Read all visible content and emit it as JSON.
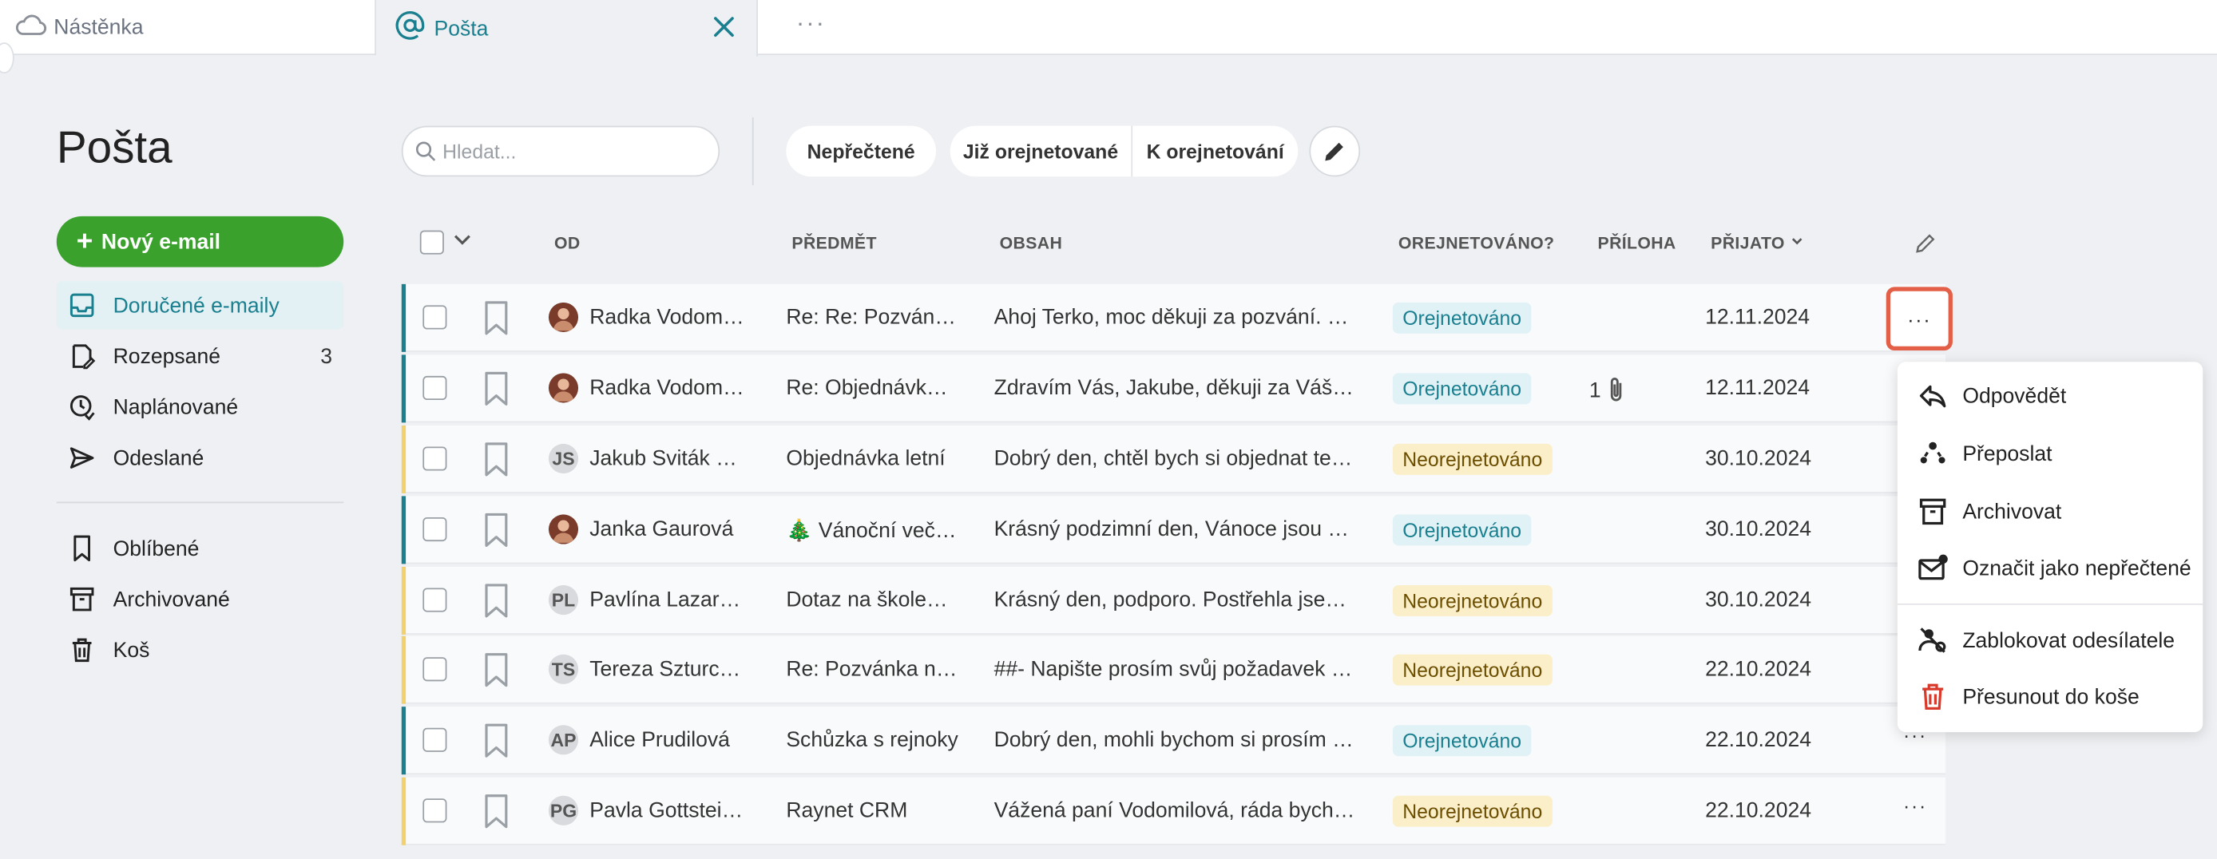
{
  "tabs": [
    {
      "label": "Nástěnka",
      "icon": "cloud-icon"
    },
    {
      "label": "Pošta",
      "icon": "at-icon",
      "active": true
    }
  ],
  "tab_more": "···",
  "page_title": "Pošta",
  "new_email_label": "Nový e-mail",
  "nav": [
    {
      "label": "Doručené e-maily",
      "icon": "inbox-icon",
      "active": true
    },
    {
      "label": "Rozepsané",
      "icon": "draft-icon",
      "count": "3"
    },
    {
      "label": "Naplánované",
      "icon": "schedule-icon"
    },
    {
      "label": "Odeslané",
      "icon": "send-icon"
    },
    {
      "label": "Oblíbené",
      "icon": "bookmark-icon"
    },
    {
      "label": "Archivované",
      "icon": "archive-icon"
    },
    {
      "label": "Koš",
      "icon": "trash-icon"
    }
  ],
  "search": {
    "placeholder": "Hledat..."
  },
  "filters": {
    "unread": "Nepřečtené",
    "rated": "Již orejnetované",
    "to_rate": "K orejnetování"
  },
  "columns": {
    "from": "OD",
    "subject": "PŘEDMĚT",
    "content": "OBSAH",
    "rated": "OREJNETOVÁNO?",
    "attachment": "PŘÍLOHA",
    "received": "PŘIJATO"
  },
  "colors": {
    "accent": "#1a7f8e",
    "primary_green": "#3aa12d",
    "highlight": "#e35f47"
  },
  "rows": [
    {
      "from": "Radka Vodomilová",
      "initials": "",
      "photo": true,
      "subject": "Re: Re: Pozvánka na Vánoční večírek",
      "body": "Ahoj Terko, moc děkuji za pozvání. Určitě dorazím.",
      "status": "Orejnetováno",
      "status_type": "yes",
      "attachment": "",
      "date": "12.11.2024"
    },
    {
      "from": "Radka Vodomilová",
      "initials": "",
      "photo": true,
      "subject": "Re: Objednávka letní",
      "body": "Zdravím Vás, Jakube, děkuji za Váš zájem",
      "status": "Orejnetováno",
      "status_type": "yes",
      "attachment": "1",
      "date": "12.11.2024"
    },
    {
      "from": "Jakub Sviták pozvánka",
      "initials": "JS",
      "photo": false,
      "subject": "Objednávka letní",
      "body": "Dobrý den, chtěl bych si objednat ten letní",
      "status": "Neorejnetováno",
      "status_type": "no",
      "attachment": "",
      "date": "30.10.2024"
    },
    {
      "from": "Janka Gaurová",
      "initials": "",
      "photo": true,
      "subject": "🎄 Vánoční večírek",
      "body": "Krásný podzimní den, Vánoce jsou za dveřmi",
      "status": "Orejnetováno",
      "status_type": "yes",
      "attachment": "",
      "date": "30.10.2024"
    },
    {
      "from": "Pavlína Lazarová",
      "initials": "PL",
      "photo": false,
      "subject": "Dotaz na školení CRM",
      "body": "Krásný den, podporo. Postřehla jsem, že",
      "status": "Neorejnetováno",
      "status_type": "no",
      "attachment": "",
      "date": "30.10.2024"
    },
    {
      "from": "Tereza Szturcová",
      "initials": "TS",
      "photo": false,
      "subject": "Re: Pozvánka na schůzku",
      "body": "##- Napište prosím svůj požadavek nad tento řádek",
      "status": "Neorejnetováno",
      "status_type": "no",
      "attachment": "",
      "date": "22.10.2024"
    },
    {
      "from": "Alice Prudilová",
      "initials": "AP",
      "photo": false,
      "subject": "Schůzka s rejnoky",
      "body": "Dobrý den, mohli bychom si prosím domluvit",
      "status": "Orejnetováno",
      "status_type": "yes",
      "attachment": "",
      "date": "22.10.2024"
    },
    {
      "from": "Pavla Gottsteinová",
      "initials": "PG",
      "photo": false,
      "subject": "Raynet CRM",
      "body": "Vážená paní Vodomilová, ráda bych Vás",
      "status": "Neorejnetováno",
      "status_type": "no",
      "attachment": "",
      "date": "22.10.2024"
    }
  ],
  "context_menu": [
    {
      "label": "Odpovědět",
      "icon": "reply-icon"
    },
    {
      "label": "Přeposlat",
      "icon": "forward-icon"
    },
    {
      "label": "Archivovat",
      "icon": "archive-icon"
    },
    {
      "label": "Označit jako nepřečtené",
      "icon": "mark-unread-icon"
    },
    {
      "label": "Zablokovat odesílatele",
      "icon": "block-sender-icon"
    },
    {
      "label": "Přesunout do koše",
      "icon": "trash-icon"
    }
  ]
}
